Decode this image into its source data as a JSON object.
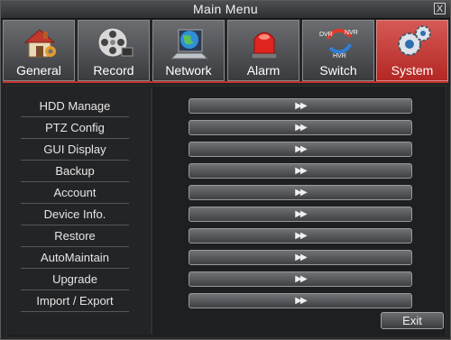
{
  "window": {
    "title": "Main Menu",
    "close_label": "X"
  },
  "tabs": [
    {
      "label": "General",
      "icon": "house-icon",
      "active": false
    },
    {
      "label": "Record",
      "icon": "film-reel-icon",
      "active": false
    },
    {
      "label": "Network",
      "icon": "globe-laptop-icon",
      "active": false
    },
    {
      "label": "Alarm",
      "icon": "siren-icon",
      "active": false
    },
    {
      "label": "Switch",
      "icon": "dvr-nvr-hvr-switch-icon",
      "active": false
    },
    {
      "label": "System",
      "icon": "gears-icon",
      "active": true
    }
  ],
  "switch_icon_text": {
    "dvr": "DVR",
    "nvr": "NVR",
    "hvr": "HVR"
  },
  "menu": [
    {
      "label": "HDD Manage",
      "arrow": "▶▶"
    },
    {
      "label": "PTZ Config",
      "arrow": "▶▶"
    },
    {
      "label": "GUI Display",
      "arrow": "▶▶"
    },
    {
      "label": "Backup",
      "arrow": "▶▶"
    },
    {
      "label": "Account",
      "arrow": "▶▶"
    },
    {
      "label": "Device Info.",
      "arrow": "▶▶"
    },
    {
      "label": "Restore",
      "arrow": "▶▶"
    },
    {
      "label": "AutoMaintain",
      "arrow": "▶▶"
    },
    {
      "label": "Upgrade",
      "arrow": "▶▶"
    },
    {
      "label": "Import / Export",
      "arrow": "▶▶"
    }
  ],
  "exit_label": "Exit",
  "colors": {
    "active_tab": "#c0302c",
    "panel": "#1e1f21",
    "text": "#e6e6e6"
  }
}
